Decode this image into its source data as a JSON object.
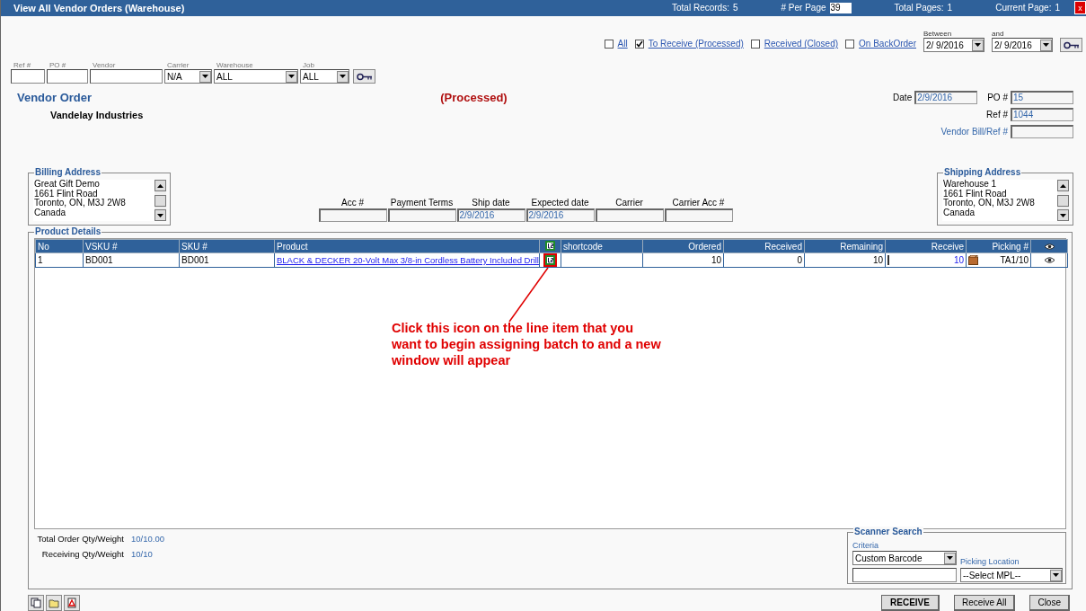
{
  "window": {
    "title": "View All Vendor Orders  (Warehouse)",
    "stats": [
      {
        "label": "Total Records:",
        "value": "5",
        "kind": "text"
      },
      {
        "label": "# Per Page",
        "value": "39",
        "kind": "input"
      },
      {
        "label": "Total Pages:",
        "value": "1",
        "kind": "text"
      },
      {
        "label": "Current Page:",
        "value": "1",
        "kind": "text"
      }
    ],
    "close": "x"
  },
  "status_filters": [
    {
      "label": "All",
      "checked": false
    },
    {
      "label": "To Receive (Processed)",
      "checked": true
    },
    {
      "label": "Received (Closed)",
      "checked": false
    },
    {
      "label": "On BackOrder",
      "checked": false
    }
  ],
  "date_range": [
    {
      "label": "Between",
      "value": "2/ 9/2016"
    },
    {
      "label": "and",
      "value": "2/ 9/2016"
    }
  ],
  "search_fields": [
    {
      "label": "Ref #",
      "kind": "text"
    },
    {
      "label": "PO #",
      "kind": "text"
    },
    {
      "label": "Vendor",
      "kind": "text"
    },
    {
      "label": "Carrier",
      "value": "N/A",
      "kind": "select"
    },
    {
      "label": "Warehouse",
      "value": "ALL",
      "kind": "select"
    },
    {
      "label": "Job",
      "value": "ALL",
      "kind": "select"
    }
  ],
  "order": {
    "heading": "Vendor Order",
    "status": "(Processed)",
    "vendor": "Vandelay Industries",
    "header_fields": [
      {
        "label": "Date",
        "value": "2/9/2016"
      },
      {
        "label": "PO #",
        "value": "15"
      },
      {
        "label": "Ref #",
        "value": "1044"
      },
      {
        "label": "Vendor Bill/Ref #"
      }
    ],
    "billing_address": {
      "title": "Billing Address",
      "lines": [
        "Great Gift Demo",
        "1661 Flint Road",
        "Toronto, ON, M3J 2W8",
        "Canada"
      ]
    },
    "shipping_address": {
      "title": "Shipping Address",
      "lines": [
        "Warehouse 1",
        "1661 Flint Road",
        "Toronto, ON, M3J 2W8",
        "Canada"
      ]
    },
    "terms": [
      {
        "label": "Acc #"
      },
      {
        "label": "Payment Terms"
      },
      {
        "label": "Ship date",
        "value": "2/9/2016"
      },
      {
        "label": "Expected date",
        "value": "2/9/2016"
      },
      {
        "label": "Carrier"
      },
      {
        "label": "Carrier Acc #"
      }
    ]
  },
  "product_details": {
    "title": "Product Details",
    "columns": [
      {
        "label": "No",
        "kind": "text"
      },
      {
        "label": "VSKU #",
        "kind": "text"
      },
      {
        "label": "SKU #",
        "kind": "text"
      },
      {
        "label": "Product",
        "kind": "text"
      },
      {
        "kind": "batch-icon"
      },
      {
        "label": "shortcode",
        "kind": "text"
      },
      {
        "label": "Ordered",
        "kind": "text"
      },
      {
        "label": "Received",
        "kind": "text"
      },
      {
        "label": "Remaining",
        "kind": "text"
      },
      {
        "label": "Receive",
        "kind": "text"
      },
      {
        "label": "Picking #",
        "kind": "text"
      },
      {
        "kind": "eye-icon"
      }
    ],
    "rows": [
      {
        "no": "1",
        "vsku": "BD001",
        "sku": "BD001",
        "product": "BLACK & DECKER  20-Volt Max  3/8-in Cordless  Battery Included Drill",
        "batch_highlighted": true,
        "ordered": "10",
        "received": "0",
        "remaining": "10",
        "receive": "10",
        "picking": "TA1/10"
      }
    ],
    "annotation": "Click this icon on the line item that you want to begin assigning batch to and a new window will appear",
    "totals": [
      {
        "label": "Total Order Qty/Weight",
        "value": "10/10.00"
      },
      {
        "label": "Receiving Qty/Weight",
        "value": "10/10"
      }
    ],
    "scanner": {
      "title": "Scanner Search",
      "criteria_label": "Criteria",
      "criteria": "Custom Barcode",
      "location_label": "Picking Location",
      "location": "--Select MPL--"
    }
  },
  "buttons": [
    {
      "label": "RECEIVE",
      "primary": true
    },
    {
      "label": "Receive All",
      "primary": false
    },
    {
      "label": "Close",
      "primary": false
    }
  ]
}
